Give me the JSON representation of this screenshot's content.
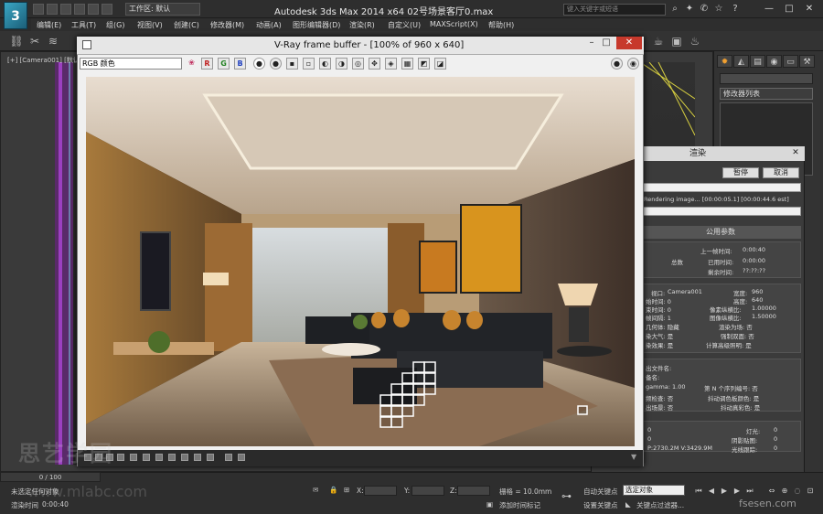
{
  "app": {
    "title": "Autodesk 3ds Max  2014 x64      02号场景客厅0.max",
    "logo": "3",
    "workspace": "工作区: 默认",
    "search_placeholder": "键入关键字或短语"
  },
  "menu": [
    "编辑(E)",
    "工具(T)",
    "组(G)",
    "视图(V)",
    "创建(C)",
    "修改器(M)",
    "动画(A)",
    "图形编辑器(D)",
    "渲染(R)",
    "自定义(U)",
    "MAXScript(X)",
    "帮助(H)"
  ],
  "viewport": {
    "label": "[+] [Camera001] [默认明暗处理]"
  },
  "command_panel": {
    "modifier_list": "修改器列表"
  },
  "vfb": {
    "title": "V-Ray frame buffer - [100% of 960 x 640]",
    "channel": "RGB 颜色",
    "channel_buttons": [
      "R",
      "G",
      "B"
    ]
  },
  "render_dialog": {
    "title": "渲染",
    "pause_label": "暂停",
    "cancel_label": "取消",
    "status": "Rendering image... [00:00:05.1] [00:00:44.6 est]",
    "section_common": "公用参数",
    "last_frame_label": "上一帧时间:",
    "last_frame_value": "0:00:40",
    "total_label": "总数",
    "elapsed_label": "已用时间:",
    "elapsed_value": "0:00:00",
    "remaining_label": "剩余时间:",
    "remaining_value": "??:??:??",
    "viewport_label": "视口:",
    "viewport_value": "Camera001",
    "width_label": "宽度:",
    "width_value": "960",
    "height_label": "高度:",
    "height_value": "640",
    "pixel_aspect_label": "像素纵横比:",
    "pixel_aspect_value": "1.00000",
    "image_aspect_label": "图像纵横比:",
    "image_aspect_value": "1.50000",
    "start_time_label": "始时间: 0",
    "end_time_label": "束时间: 0",
    "nth_frame_label": "帧间隔: 1",
    "hidden_label": "几何体: 隐藏",
    "render_to_field_label": "渲染为场: 否",
    "atmo_label": "染大气: 是",
    "force_2side_label": "强制双面: 否",
    "effects_label": "染效果: 是",
    "subpixel_label": "计算高级照明: 是",
    "output_file_label": "出文件名:",
    "device_label": "备名:",
    "gamma_label": "gamma: 1.00",
    "nth_serial_label": "第 N 个序列编号: 否",
    "video_check_label": "频检查: 否",
    "dither_palette_label": "抖动调色板颜色: 是",
    "output_label": "出场景: 否",
    "dither_true_label": "抖动真彩色: 是",
    "lights_label": "灯光:",
    "lights_value": "0",
    "shadow_label": "阴影贴图:",
    "shadow_value": "0",
    "raytrace_label": "光线跟踪:",
    "raytrace_value": "0",
    "count_a_label": "0",
    "count_b_label": "0",
    "mem_label": "P:2730.2M V:3429.9M"
  },
  "status": {
    "time_slider": "0 / 100",
    "selection": "未选定任何对象",
    "render_time_label": "渲染时间",
    "render_time_value": "0:00:40",
    "x_label": "X:",
    "y_label": "Y:",
    "z_label": "Z:",
    "grid": "栅格 = 10.0mm",
    "add_time_tag": "添加时间标记",
    "auto_key": "自动关键点",
    "set_key": "设置关键点",
    "key_filter_select": "选定对象",
    "key_filters": "关键点过滤器..."
  },
  "watermarks": {
    "top": "思艺学园",
    "mid": "www.mlabc.com",
    "corner": "fsesen.com"
  }
}
